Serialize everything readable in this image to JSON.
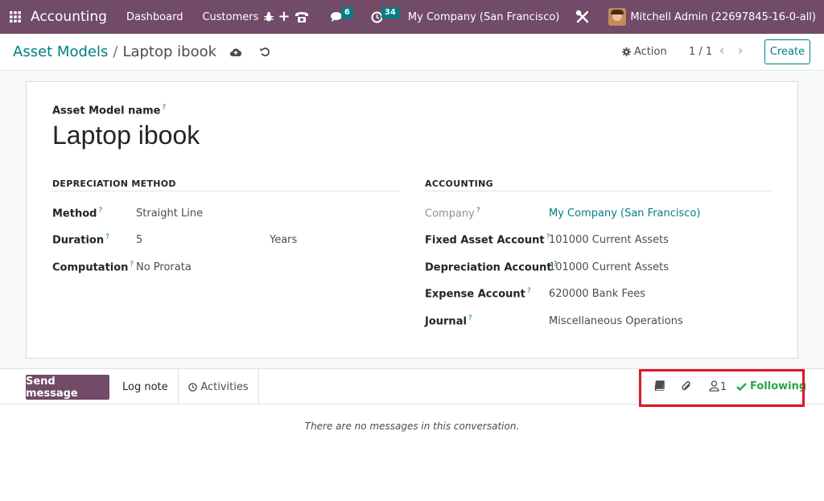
{
  "navbar": {
    "app_name": "Accounting",
    "menu": [
      "Dashboard",
      "Customers"
    ],
    "quick_create_label": "+",
    "messages_count": "6",
    "activities_count": "34",
    "company": "My Company (San Francisco)",
    "user": "Mitchell Admin (22697845-16-0-all)",
    "icons": [
      "apps-grid-icon",
      "bug-icon",
      "phone-icon",
      "chat-icon",
      "clock-icon",
      "tools-icon"
    ]
  },
  "control_panel": {
    "breadcrumb_parent": "Asset Models",
    "breadcrumb_separator": "/",
    "breadcrumb_current": "Laptop ibook",
    "action_label": "Action",
    "pager": "1 / 1",
    "create_label": "Create"
  },
  "form": {
    "name_label": "Asset Model name",
    "help_mark": "?",
    "name_value": "Laptop ibook",
    "depreciation": {
      "title": "DEPRECIATION METHOD",
      "fields": [
        {
          "label": "Method",
          "value": "Straight Line"
        },
        {
          "label": "Duration",
          "value": "5",
          "unit": "Years"
        },
        {
          "label": "Computation",
          "value": "No Prorata"
        }
      ]
    },
    "accounting": {
      "title": "ACCOUNTING",
      "fields": [
        {
          "label": "Company",
          "value": "My Company (San Francisco)"
        },
        {
          "label": "Fixed Asset Account",
          "value": "101000 Current Assets"
        },
        {
          "label": "Depreciation Account",
          "value": "101000 Current Assets"
        },
        {
          "label": "Expense Account",
          "value": "620000 Bank Fees"
        },
        {
          "label": "Journal",
          "value": "Miscellaneous Operations"
        }
      ]
    }
  },
  "chatter": {
    "send_message": "Send message",
    "log_note": "Log note",
    "activities": "Activities",
    "followers_count": "1",
    "following": "Following",
    "empty_text": "There are no messages in this conversation."
  },
  "colors": {
    "brand": "#714b67",
    "link": "#017e84",
    "success": "#28a745",
    "highlight": "#e0162b"
  }
}
